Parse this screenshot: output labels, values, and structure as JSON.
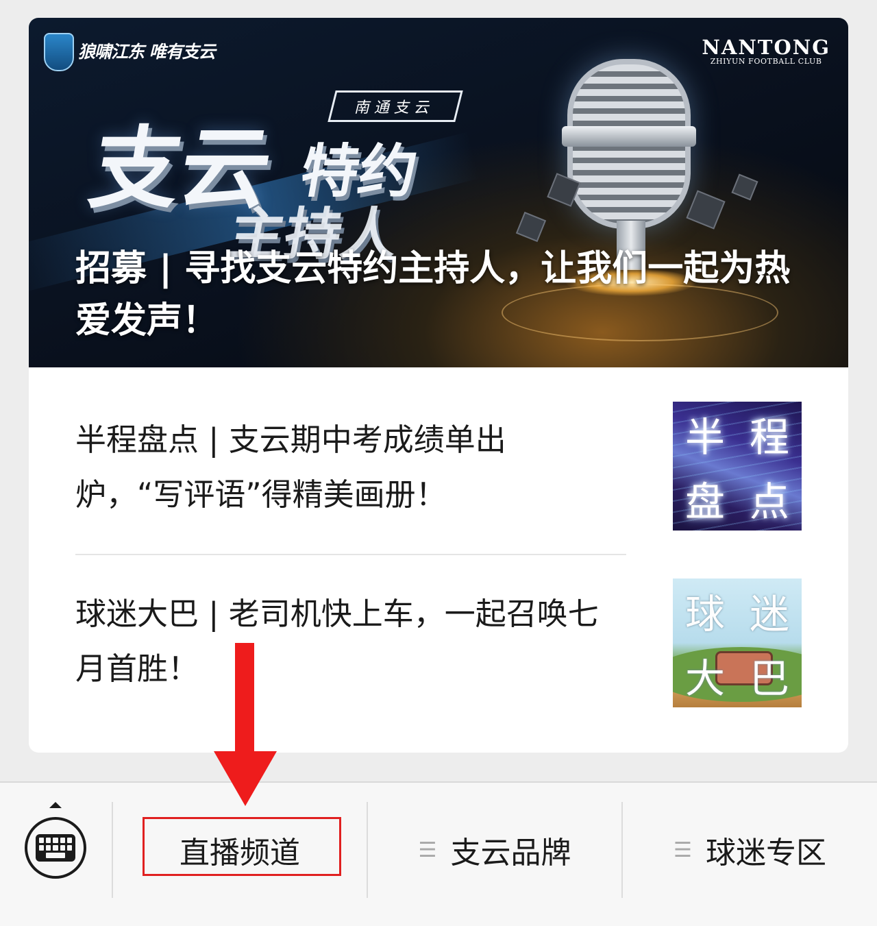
{
  "hero": {
    "slogan": "狼啸江东 唯有支云",
    "brand_title": "NANTONG",
    "brand_subtitle": "ZHIYUN FOOTBALL CLUB",
    "tag": "南通支云",
    "art_line1": "支云",
    "art_line2": "特约",
    "art_line3": "主持人",
    "headline": "招募 | 寻找支云特约主持人，让我们一起为热爱发声！"
  },
  "articles": [
    {
      "title": "半程盘点 | 支云期中考成绩单出炉，“写评语”得精美画册！",
      "thumb_chars": [
        "半",
        "程",
        "盘",
        "点"
      ]
    },
    {
      "title": "球迷大巴 | 老司机快上车，一起召唤七月首胜！",
      "thumb_chars": [
        "球",
        "迷",
        "大",
        "巴"
      ]
    }
  ],
  "menu": {
    "keyboard_icon": "keyboard-icon",
    "items": [
      {
        "label": "直播频道",
        "icon": ""
      },
      {
        "label": "支云品牌",
        "icon": "menu-lines-icon"
      },
      {
        "label": "球迷专区",
        "icon": "menu-lines-icon"
      }
    ]
  },
  "annotation": {
    "arrow_color": "#ee1c1c",
    "box_color": "#e02020",
    "target": "直播频道"
  }
}
